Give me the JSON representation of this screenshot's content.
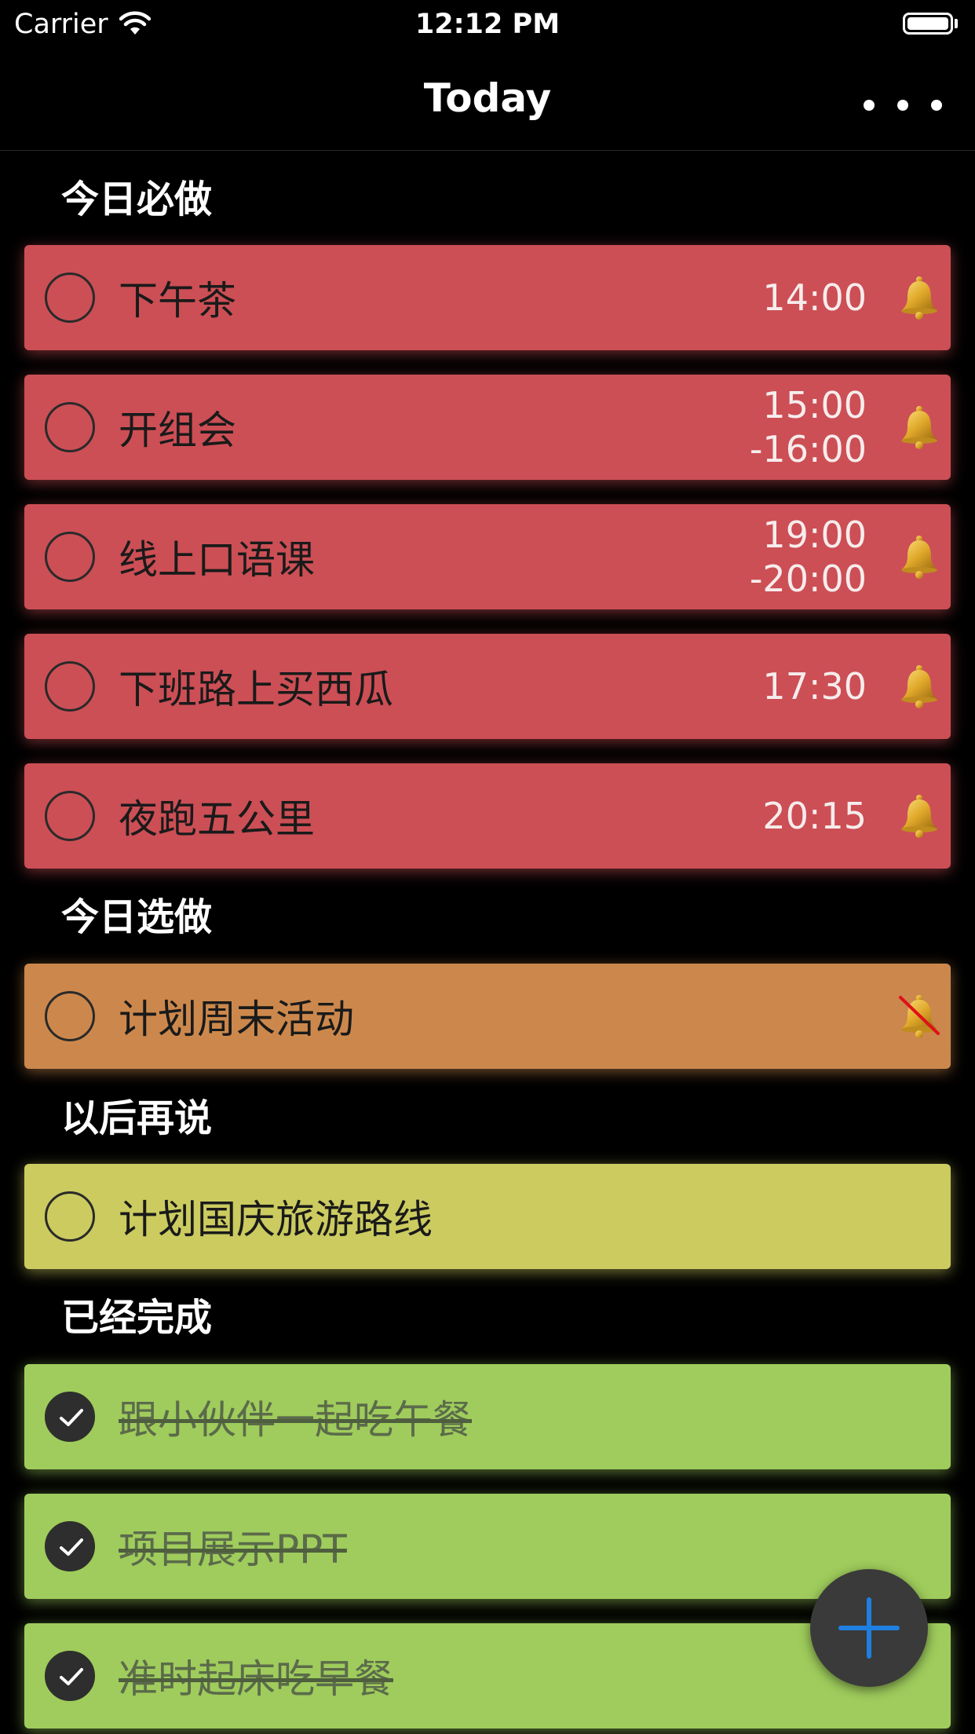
{
  "status_bar": {
    "carrier": "Carrier",
    "time": "12:12 PM"
  },
  "nav": {
    "title": "Today"
  },
  "sections": [
    {
      "title": "今日必做",
      "tasks": [
        {
          "title": "下午茶",
          "time": "14:00",
          "alarm": "bell-icon",
          "done": false
        },
        {
          "title": "开组会",
          "time": "15:00\n-16:00",
          "alarm": "bell-icon",
          "done": false
        },
        {
          "title": "线上口语课",
          "time": "19:00\n-20:00",
          "alarm": "bell-icon",
          "done": false
        },
        {
          "title": "下班路上买西瓜",
          "time": "17:30",
          "alarm": "bell-icon",
          "done": false
        },
        {
          "title": "夜跑五公里",
          "time": "20:15",
          "alarm": "bell-icon",
          "done": false
        }
      ]
    },
    {
      "title": "今日选做",
      "tasks": [
        {
          "title": "计划周末活动",
          "time": "",
          "alarm": "bell-off-icon",
          "done": false
        }
      ]
    },
    {
      "title": "以后再说",
      "tasks": [
        {
          "title": "计划国庆旅游路线",
          "time": "",
          "alarm": "",
          "done": false
        }
      ]
    },
    {
      "title": "已经完成",
      "tasks": [
        {
          "title": "跟小伙伴一起吃午餐",
          "time": "",
          "alarm": "",
          "done": true
        },
        {
          "title": "项目展示PPT",
          "time": "",
          "alarm": "",
          "done": true
        },
        {
          "title": "准时起床吃早餐",
          "time": "",
          "alarm": "",
          "done": true
        }
      ]
    }
  ],
  "colors": {
    "must_do": "#cc4f55",
    "optional": "#cc884c",
    "later": "#cbcb60",
    "done": "#9fcc5c",
    "fab_plus": "#1e7fe0"
  },
  "fab": {
    "icon": "plus-icon"
  }
}
